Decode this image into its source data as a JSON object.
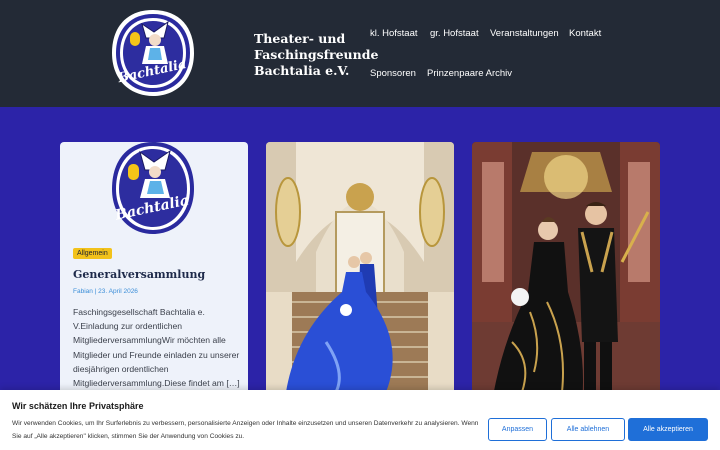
{
  "header": {
    "logo_text": "Bachtalia",
    "site_title": "Theater- und Faschingsfreunde Bachtalia e.V.",
    "nav": [
      "kl. Hofstaat",
      "gr. Hofstaat",
      "Veranstaltungen",
      "Kontakt",
      "Sponsoren",
      "Prinzenpaare Archiv"
    ]
  },
  "posts": [
    {
      "category": "Allgemein",
      "title": "Generalversammlung",
      "meta": "Fabian | 23. April 2026",
      "excerpt": "Faschingsgesellschaft Bachtalia e. V.Einladung zur ordentlichen MitgliederversammlungWir möchten alle Mitglieder und Freunde einladen zu unserer diesjährigen ordentlichen Mitgliederversammlung.Diese findet am […]"
    }
  ],
  "cookie": {
    "title": "Wir schätzen Ihre Privatsphäre",
    "text": "Wir verwenden Cookies, um Ihr Surferlebnis zu verbessern, personalisierte Anzeigen oder Inhalte einzusetzen und unseren Datenverkehr zu analysieren. Wenn Sie auf „Alle akzeptieren\" klicken, stimmen Sie der Anwendung von Cookies zu.",
    "customize": "Anpassen",
    "reject": "Alle ablehnen",
    "accept": "Alle akzeptieren"
  },
  "colors": {
    "header_bg": "#232a36",
    "page_bg": "#2c23a8",
    "badge": "#f2c21a",
    "primary_button": "#1f6fd8"
  }
}
